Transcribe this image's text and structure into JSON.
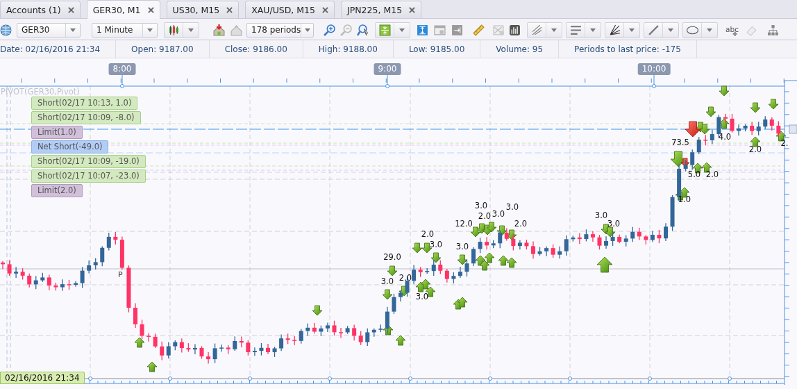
{
  "tabs": [
    {
      "label": "Accounts (1)",
      "selected": false
    },
    {
      "label": "GER30, M1",
      "selected": true
    },
    {
      "label": "US30, M15",
      "selected": false
    },
    {
      "label": "XAU/USD, M15",
      "selected": false
    },
    {
      "label": "JPN225, M15",
      "selected": false
    }
  ],
  "toolbar": {
    "symbol": "GER30",
    "timeframe": "1 Minute",
    "periods": "178 periods",
    "text_tool_label": "abc"
  },
  "info_bar": [
    "Date: 02/16/2016 21:34",
    "Open: 9187.00",
    "Close: 9186.00",
    "High: 9188.00",
    "Low: 9185.00",
    "Volume: 95",
    "Periods to last price: -175"
  ],
  "chart": {
    "time_labels": [
      "8:00",
      "9:00",
      "10:00"
    ],
    "indicator": "PIVOT(GER30,Pivot)",
    "order_tags": [
      {
        "label": "Short(02/17 10:13, 1.0)",
        "kind": "short"
      },
      {
        "label": "Short(02/17 10:09, -8.0)",
        "kind": "short"
      },
      {
        "label": "Limit(1.0)",
        "kind": "limit"
      },
      {
        "label": "Net Short(-49.0)",
        "kind": "net"
      },
      {
        "label": "Short(02/17 10:09, -19.0)",
        "kind": "short"
      },
      {
        "label": "Short(02/17 10:07, -23.0)",
        "kind": "short"
      },
      {
        "label": "Limit(2.0)",
        "kind": "limit"
      }
    ],
    "pivot_label": "P",
    "trade_labels": [
      "29.0",
      "3.0",
      "2.0",
      "3.0",
      "2.0",
      "3.0",
      "3.0",
      "12.0",
      "3.0",
      "2.0",
      "3.0",
      "3.0",
      "2.0",
      "3.0",
      "3.0",
      "73.5",
      "1.0",
      "5.0",
      "2.0",
      "4.0",
      "2.0",
      "2."
    ],
    "cursor_time": "02/16/2016 21:34"
  }
}
